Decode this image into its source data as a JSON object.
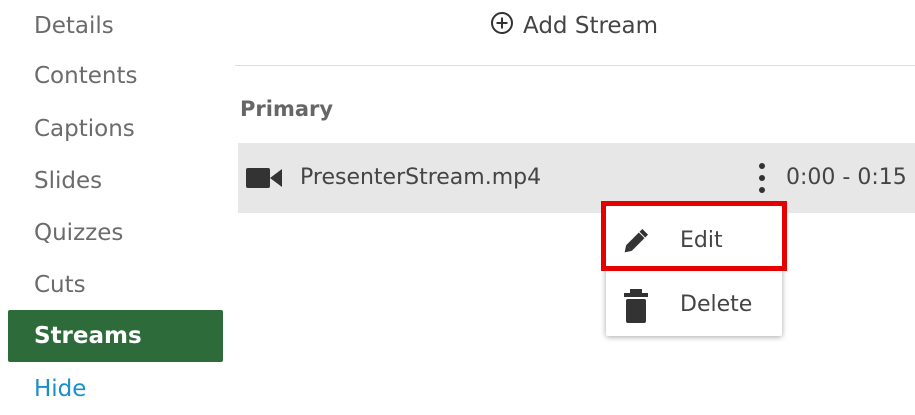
{
  "sidebar": {
    "items": [
      {
        "label": "Details"
      },
      {
        "label": "Contents"
      },
      {
        "label": "Captions"
      },
      {
        "label": "Slides"
      },
      {
        "label": "Quizzes"
      },
      {
        "label": "Cuts"
      },
      {
        "label": "Streams",
        "active": true
      },
      {
        "label": "Hide"
      }
    ]
  },
  "toolbar": {
    "add_stream_label": "Add Stream",
    "add_icon": "plus-circle-icon"
  },
  "primary": {
    "section_title": "Primary",
    "stream": {
      "icon": "video-camera-icon",
      "name": "PresenterStream.mp4",
      "time": "0:00 - 0:15"
    }
  },
  "context_menu": {
    "items": [
      {
        "label": "Edit",
        "icon": "pencil-icon"
      },
      {
        "label": "Delete",
        "icon": "trash-icon"
      }
    ]
  },
  "colors": {
    "active_nav": "#2e6b3b",
    "link": "#1a8fc9",
    "highlight": "#e60000",
    "row_bg": "#e7e7e7"
  }
}
